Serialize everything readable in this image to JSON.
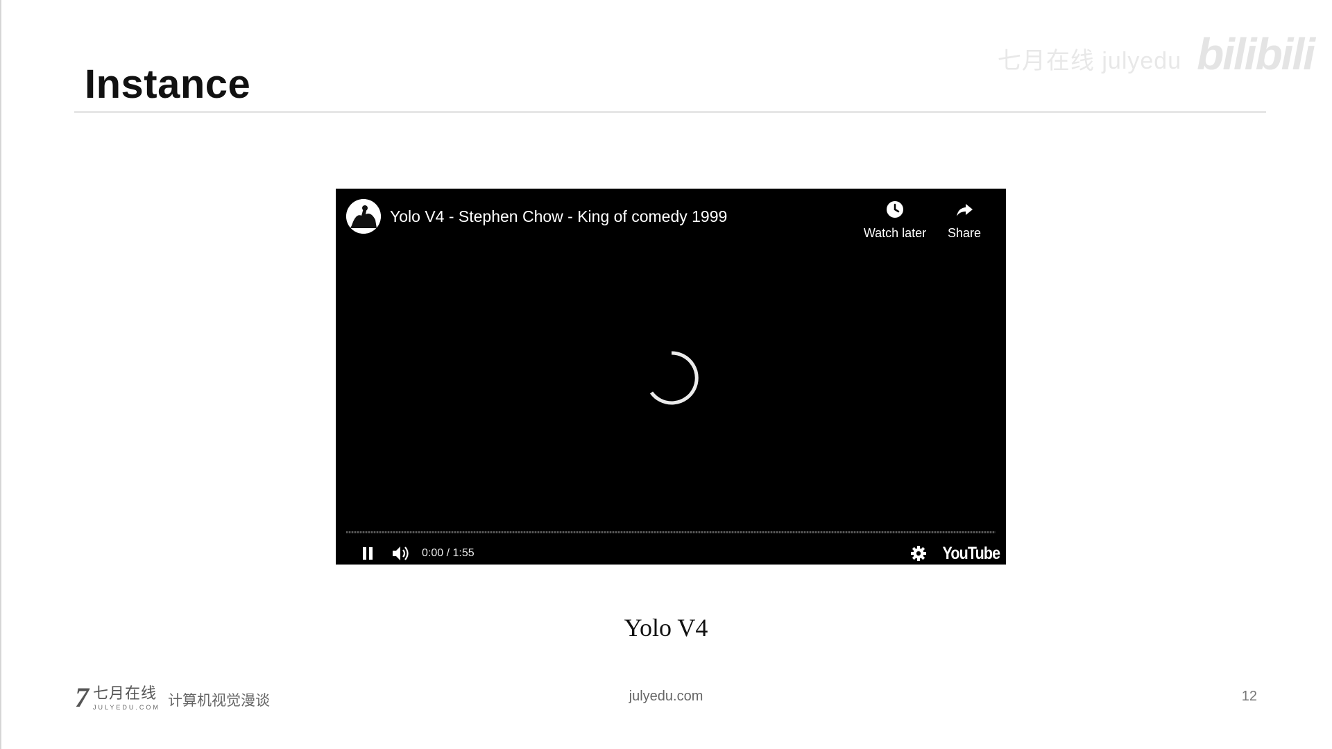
{
  "slide": {
    "title": "Instance",
    "caption": "Yolo V4"
  },
  "watermark": {
    "text": "七月在线 julyedu",
    "logo": "bilibili"
  },
  "player": {
    "video_title": "Yolo V4 - Stephen Chow - King of comedy 1999",
    "watch_later_label": "Watch later",
    "share_label": "Share",
    "time": "0:00 / 1:55",
    "progress": 0,
    "brand": "YouTube",
    "icons": [
      "channel-avatar",
      "clock-icon",
      "share-arrow-icon",
      "loading-spinner",
      "pause-icon",
      "volume-icon",
      "gear-icon"
    ]
  },
  "footer": {
    "brand_cn": "七月在线",
    "brand_en": "JULYEDU.COM",
    "course": "计算机视觉漫谈",
    "url": "julyedu.com",
    "page_number": "12"
  }
}
